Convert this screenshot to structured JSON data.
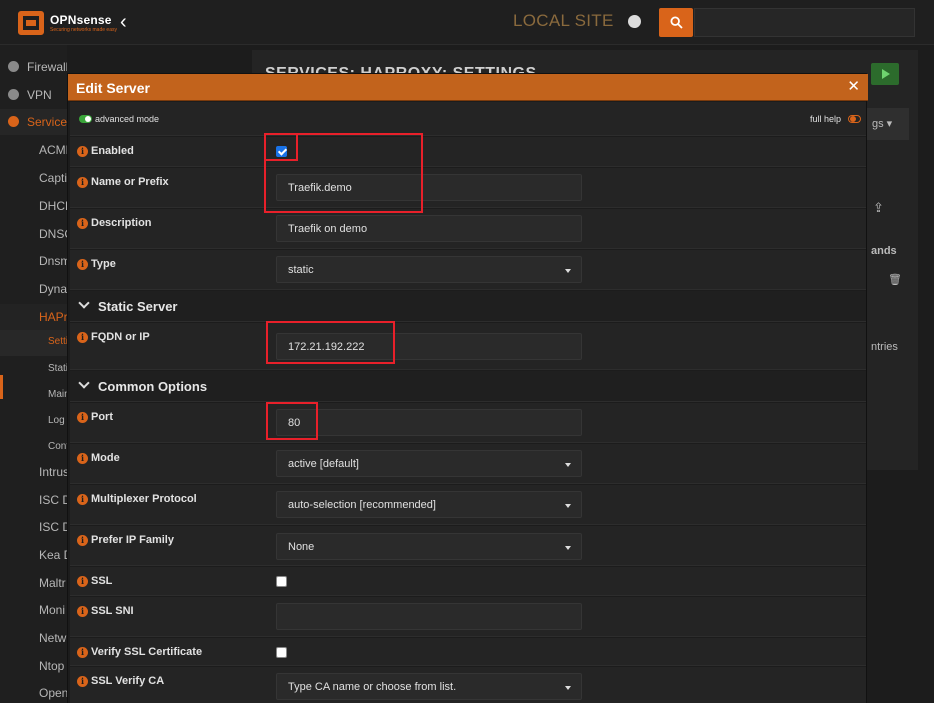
{
  "topbar": {
    "logo_name": "OPNsense",
    "logo_tagline": "Securing networks made easy",
    "site_name": "LOCAL SITE"
  },
  "sidebar": {
    "items": [
      {
        "label": "Firewall"
      },
      {
        "label": "VPN"
      },
      {
        "label": "Services"
      },
      {
        "label": "ACME"
      },
      {
        "label": "Captive"
      },
      {
        "label": "DHCPv"
      },
      {
        "label": "DNSCr"
      },
      {
        "label": "Dnsm"
      },
      {
        "label": "Dynam"
      },
      {
        "label": "HAProxy"
      },
      {
        "label": "Settings"
      },
      {
        "label": "Statistics"
      },
      {
        "label": "Maintenance"
      },
      {
        "label": "Log File"
      },
      {
        "label": "Config"
      },
      {
        "label": "Intrus"
      },
      {
        "label": "ISC D"
      },
      {
        "label": "ISC D"
      },
      {
        "label": "Kea D"
      },
      {
        "label": "Maltr"
      },
      {
        "label": "Moni"
      },
      {
        "label": "Netw"
      },
      {
        "label": "Ntop"
      },
      {
        "label": "Open"
      }
    ]
  },
  "background": {
    "page_title": "SERVICES: HAPROXY: SETTINGS",
    "tab_label": "gs",
    "col_commands": "ands",
    "entries_text": "ntries"
  },
  "modal": {
    "title": "Edit Server",
    "close_symbol": "✕",
    "advanced_mode_label": "advanced mode",
    "full_help_label": "full help",
    "fields": {
      "enabled": {
        "label": "Enabled",
        "checked": true
      },
      "name": {
        "label": "Name or Prefix",
        "value": "Traefik.demo"
      },
      "description": {
        "label": "Description",
        "value": "Traefik on demo"
      },
      "type": {
        "label": "Type",
        "value": "static"
      },
      "fqdn": {
        "label": "FQDN or IP",
        "value": "172.21.192.222"
      },
      "port": {
        "label": "Port",
        "value": "80"
      },
      "mode": {
        "label": "Mode",
        "value": "active [default]"
      },
      "multiplexer": {
        "label": "Multiplexer Protocol",
        "value": "auto-selection [recommended]"
      },
      "prefer_ip": {
        "label": "Prefer IP Family",
        "value": "None"
      },
      "ssl": {
        "label": "SSL",
        "checked": false
      },
      "ssl_sni": {
        "label": "SSL SNI",
        "value": ""
      },
      "verify_ssl": {
        "label": "Verify SSL Certificate",
        "checked": false
      },
      "ssl_verify_ca": {
        "label": "SSL Verify CA",
        "placeholder": "Type CA name or choose from list."
      }
    },
    "sections": {
      "static_server": "Static Server",
      "common_options": "Common Options"
    }
  },
  "colors": {
    "accent": "#d9641a",
    "highlight": "#e8202a",
    "checkbox_checked": "#1a73e8"
  }
}
